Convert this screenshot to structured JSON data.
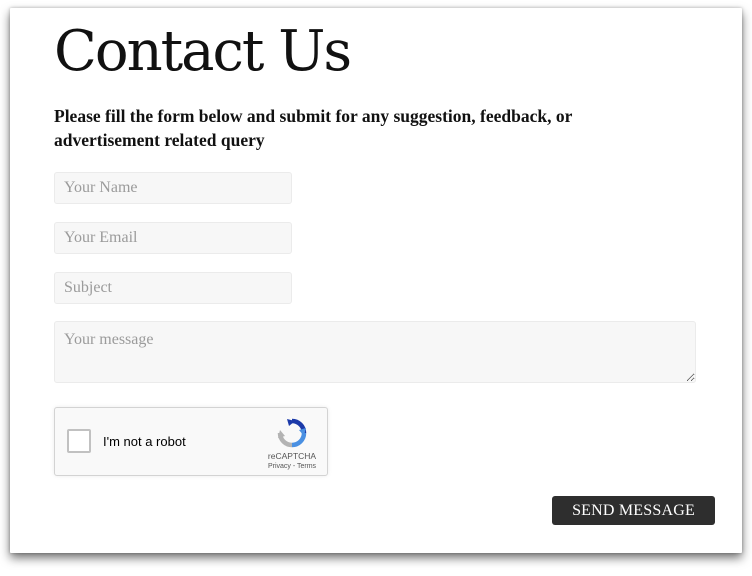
{
  "page": {
    "title": "Contact Us",
    "intro": "Please fill the form below and submit for any suggestion, feedback, or advertisement related query"
  },
  "form": {
    "name_placeholder": "Your Name",
    "email_placeholder": "Your Email",
    "subject_placeholder": "Subject",
    "message_placeholder": "Your message",
    "name_value": "",
    "email_value": "",
    "subject_value": "",
    "message_value": ""
  },
  "captcha": {
    "label": "I'm not a robot",
    "brand": "reCAPTCHA",
    "links": "Privacy - Terms",
    "checked": false,
    "icon": "recaptcha-logo"
  },
  "actions": {
    "send_label": "SEND MESSAGE"
  },
  "colors": {
    "button_bg": "#2e2e2e",
    "field_bg": "#f7f7f7",
    "recaptcha_blue": "#4a90e2",
    "recaptcha_gray": "#b3b3b3"
  }
}
